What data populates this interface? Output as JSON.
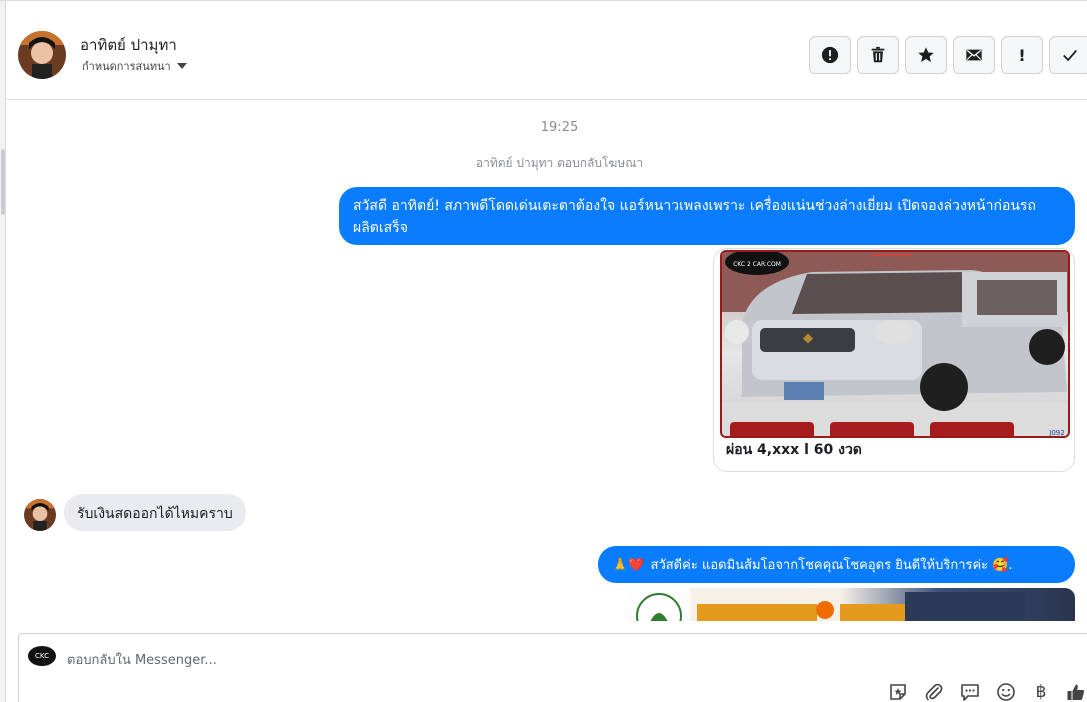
{
  "header": {
    "name": "อาทิตย์ ปามุทา",
    "subtitle": "กำหนดการสนทนา",
    "actions": [
      {
        "icon": "alert-circle-icon",
        "label": "!"
      },
      {
        "icon": "trash-icon"
      },
      {
        "icon": "star-icon"
      },
      {
        "icon": "mail-icon"
      },
      {
        "icon": "exclamation-icon",
        "label": "!"
      },
      {
        "icon": "check-icon"
      }
    ]
  },
  "thread": {
    "time": "19:25",
    "reply_note": "อาทิตย์ ปามุทา ตอบกลับโฆษณา",
    "messages": {
      "out1": "สวัสดี อาทิตย์! สภาพดีโดดเด่นเตะตาต้องใจ แอร์หนาวเพลงเพราะ เครื่องแน่นช่วงล่างเยี่ยม เปิดจองล่วงหน้าก่อนรถผลิตเสร็จ",
      "card_caption": "ผ่อน 4,xxx l 60 งวด",
      "card_watermark": "CKC 2 CAR.COM",
      "card_tag": "J092",
      "in1": "รับเงินสดออกได้ไหมคราบ",
      "out2_emojis": "🙏❤️",
      "out2": "สวัสดีค่ะ แอดมินส้มโอจากโชคคุณโชคอุดร ยินดีให้บริการค่ะ",
      "out2_tail": "🥰."
    }
  },
  "composer": {
    "placeholder": "ตอบกลับใน Messenger...",
    "logo_text": "CKC",
    "tools": [
      "sticker-icon",
      "attach-icon",
      "chat-bubble-icon",
      "emoji-icon",
      "baht-icon",
      "like-icon"
    ],
    "baht_symbol": "฿"
  },
  "colors": {
    "outgoing": "#0a7cff",
    "incoming": "#e9ebee",
    "border": "#dadde1"
  }
}
